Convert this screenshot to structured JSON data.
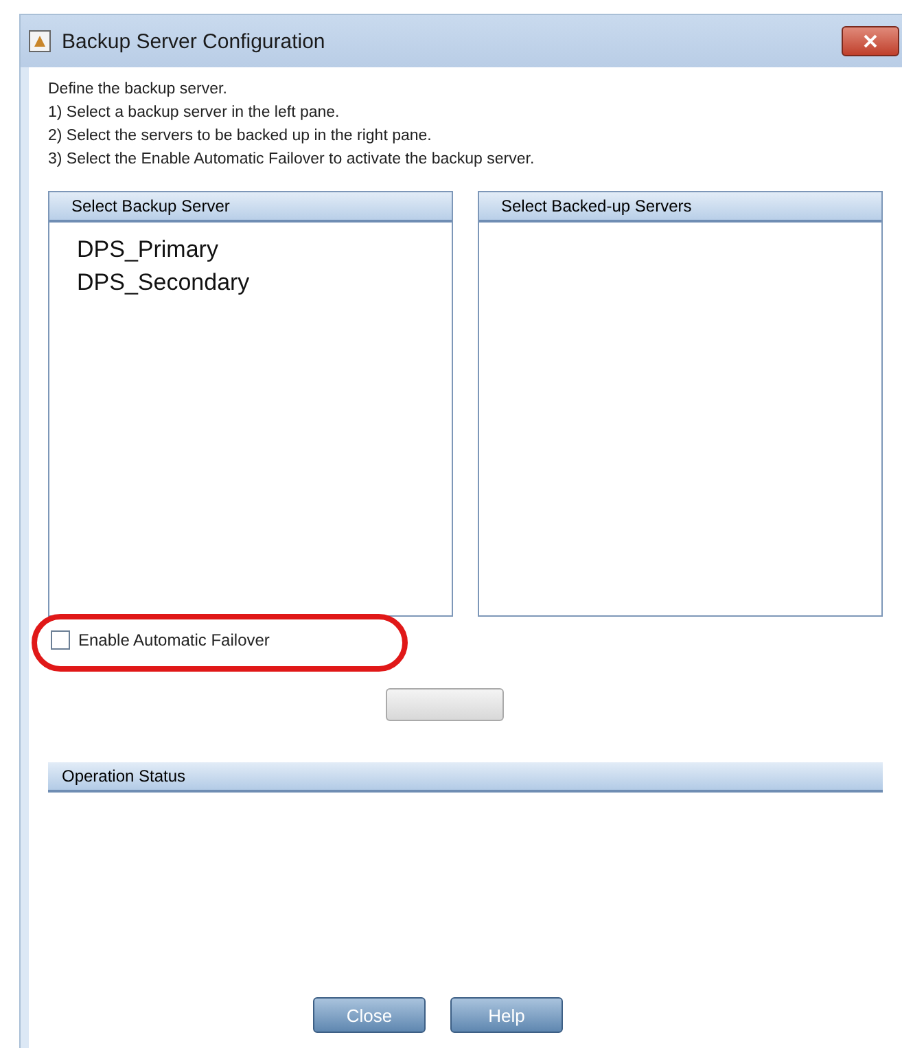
{
  "window": {
    "title": "Backup Server Configuration"
  },
  "instructions": [
    "Define the backup server.",
    "1) Select a backup server in the left pane.",
    "2) Select the servers to be backed up in the right pane.",
    "3) Select the Enable Automatic Failover to activate the backup server."
  ],
  "backup_pane": {
    "header": "Select Backup Server",
    "items": [
      {
        "label": "DPS_Primary",
        "selected": false
      },
      {
        "label": "DPS_Secondary",
        "selected": false
      }
    ]
  },
  "backed_up_pane": {
    "header": "Select Backed-up Servers"
  },
  "failover": {
    "label": "Enable Automatic Failover",
    "checked": false,
    "highlighted": true
  },
  "apply_button": {
    "disabled": true
  },
  "status": {
    "header": "Operation Status"
  },
  "buttons": [
    "Close",
    "Help"
  ]
}
